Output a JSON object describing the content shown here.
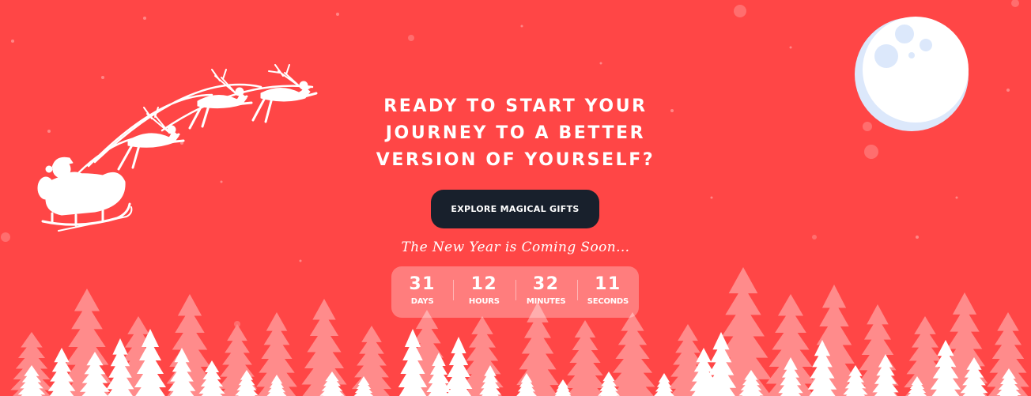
{
  "hero": {
    "headline_lines": [
      "READY TO START YOUR",
      "JOURNEY TO A BETTER",
      "VERSION OF YOURSELF?"
    ],
    "cta_label": "EXPLORE MAGICAL GIFTS",
    "tagline": "The New Year is Coming Soon..."
  },
  "countdown": [
    {
      "value": "31",
      "label": "DAYS"
    },
    {
      "value": "12",
      "label": "HOURS"
    },
    {
      "value": "32",
      "label": "MINUTES"
    },
    {
      "value": "11",
      "label": "SECONDS"
    }
  ],
  "colors": {
    "background": "#ff4646",
    "cta_background": "#18202c",
    "text": "#ffffff",
    "moon": "#ffffff",
    "moon_shadow": "#dce8fb",
    "tree_far": "#ff8b8b",
    "tree_near": "#ffffff"
  },
  "decor": {
    "moon_icon": "moon-icon",
    "sleigh_icon": "santa-sleigh-icon",
    "reindeer_icon": "reindeer-icon",
    "tree_icon": "pine-tree-icon",
    "snow_icon": "snowflake-icon"
  }
}
